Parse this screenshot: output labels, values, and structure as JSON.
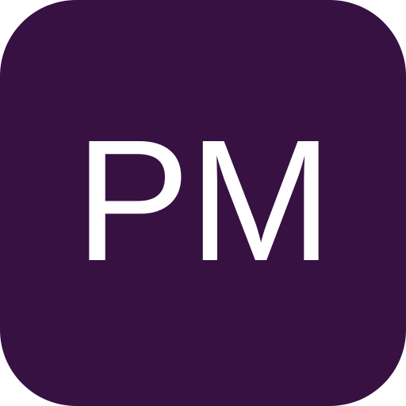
{
  "icon": {
    "monogram": "PM",
    "background_color": "#371142",
    "text_color": "#ffffff"
  }
}
